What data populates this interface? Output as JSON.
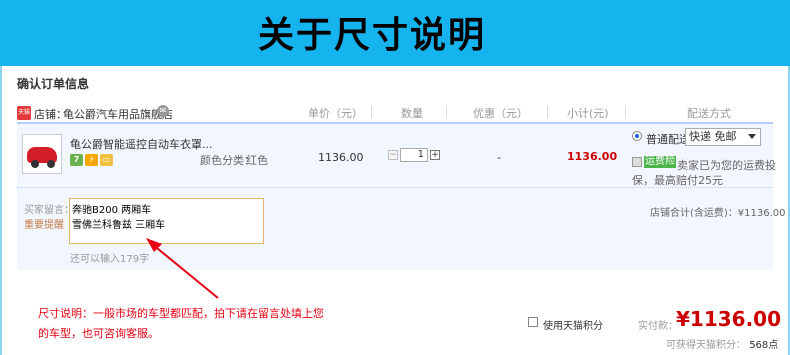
{
  "banner": {
    "title": "关于尺寸说明",
    "color": "#16b4ef"
  },
  "order": {
    "section_title": "确认订单信息",
    "shop": {
      "icon": "tmall-shop-icon",
      "icon_text": "天猫",
      "label": "店铺：",
      "name": "龟公爵汽车用品旗舰店"
    },
    "columns": [
      "单价（元）",
      "数量",
      "优惠（元）",
      "小计(元)",
      "配送方式"
    ],
    "item": {
      "title": "龟公爵智能遥控自动车衣罩...",
      "badges": [
        "7",
        "⚡",
        "💳"
      ],
      "sku_label": "颜色分类：",
      "sku_value": "红色",
      "unit_price": "1136.00",
      "quantity": "1",
      "discount": "-",
      "subtotal": "1136.00"
    },
    "shipping": {
      "option_label": "普通配送",
      "selected": "快递 免邮",
      "insurance_tag": "运费险",
      "insurance_text1": "卖家已为您的运费投",
      "insurance_text2": "保，最高赔付25元"
    },
    "message": {
      "label": "买家留言：",
      "hint": "重要提醒",
      "line1": "奔驰B200 两厢车",
      "line2": "雪佛兰科鲁兹 三厢车",
      "remaining": "还可以输入179字"
    },
    "shop_total": "店铺合计(含运费)：¥1136.00"
  },
  "note": "尺寸说明：一般市场的车型都匹配，拍下请在留言处填上您的车型，也可咨询客服。",
  "footer": {
    "tmall_points_label": "使用天猫积分",
    "pay_label": "实付款：",
    "pay_amount": "¥1136.00",
    "points_label": "可获得天猫积分：",
    "points_value": "568点"
  },
  "colors": {
    "price_red": "#cc0000",
    "note_red": "#e60012",
    "row_bg": "#f2f7ff"
  }
}
